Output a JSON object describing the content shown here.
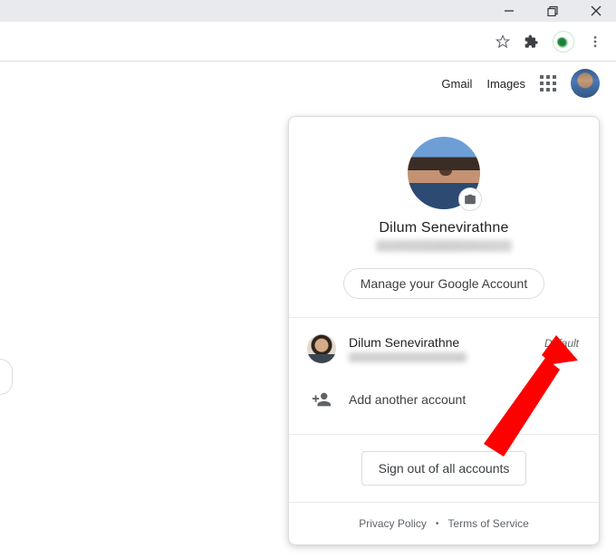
{
  "window": {
    "minimize_icon": "minimize-icon",
    "maximize_icon": "maximize-icon",
    "close_icon": "close-icon"
  },
  "nav": {
    "gmail_label": "Gmail",
    "images_label": "Images"
  },
  "account_dropdown": {
    "primary_name": "Dilum Senevirathne",
    "manage_label": "Manage your Google Account",
    "second_account_name": "Dilum Senevirathne",
    "default_badge": "Default",
    "add_account_label": "Add another account",
    "signout_label": "Sign out of all accounts",
    "privacy_label": "Privacy Policy",
    "terms_label": "Terms of Service"
  }
}
